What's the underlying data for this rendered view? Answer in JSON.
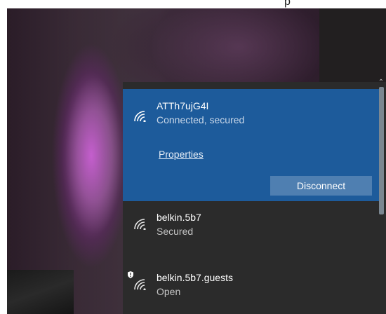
{
  "window": {
    "top_glyph": "p"
  },
  "wifi_panel": {
    "networks": [
      {
        "ssid": "ATTh7ujG4I",
        "status": "Connected, secured",
        "properties_label": "Properties",
        "action_label": "Disconnect",
        "icon": "wifi-signal-icon",
        "state": "connected"
      },
      {
        "ssid": "belkin.5b7",
        "status": "Secured",
        "icon": "wifi-signal-icon",
        "state": "available"
      },
      {
        "ssid": "belkin.5b7.guests",
        "status": "Open",
        "icon": "wifi-open-warning-icon",
        "state": "available"
      }
    ],
    "colors": {
      "panel_bg": "#2b2b2b",
      "selected_bg": "#1d5b9b",
      "button_bg": "#4f7fb1",
      "text": "#ffffff",
      "scrollbar": "#7b8791"
    }
  }
}
